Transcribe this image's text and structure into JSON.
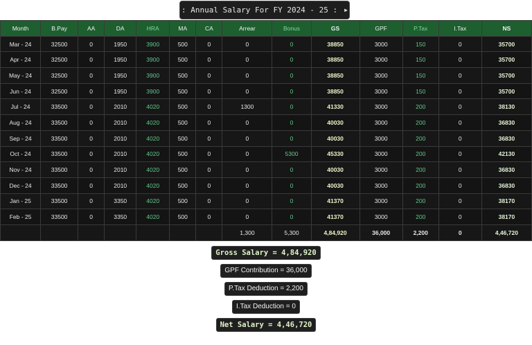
{
  "title": {
    "label": ": Annual Salary For FY  2024 - 25 :",
    "next_icon": "triangle-right-icon"
  },
  "table": {
    "columns": [
      "Month",
      "B.Pay",
      "AA",
      "DA",
      "HRA",
      "MA",
      "CA",
      "Arrear",
      "Bonus",
      "GS",
      "GPF",
      "P.Tax",
      "I.Tax",
      "NS"
    ],
    "rows": [
      [
        "Mar - 24",
        "32500",
        "0",
        "1950",
        "3900",
        "500",
        "0",
        "0",
        "0",
        "38850",
        "3000",
        "150",
        "0",
        "35700"
      ],
      [
        "Apr - 24",
        "32500",
        "0",
        "1950",
        "3900",
        "500",
        "0",
        "0",
        "0",
        "38850",
        "3000",
        "150",
        "0",
        "35700"
      ],
      [
        "May - 24",
        "32500",
        "0",
        "1950",
        "3900",
        "500",
        "0",
        "0",
        "0",
        "38850",
        "3000",
        "150",
        "0",
        "35700"
      ],
      [
        "Jun - 24",
        "32500",
        "0",
        "1950",
        "3900",
        "500",
        "0",
        "0",
        "0",
        "38850",
        "3000",
        "150",
        "0",
        "35700"
      ],
      [
        "Jul - 24",
        "33500",
        "0",
        "2010",
        "4020",
        "500",
        "0",
        "1300",
        "0",
        "41330",
        "3000",
        "200",
        "0",
        "38130"
      ],
      [
        "Aug - 24",
        "33500",
        "0",
        "2010",
        "4020",
        "500",
        "0",
        "0",
        "0",
        "40030",
        "3000",
        "200",
        "0",
        "36830"
      ],
      [
        "Sep - 24",
        "33500",
        "0",
        "2010",
        "4020",
        "500",
        "0",
        "0",
        "0",
        "40030",
        "3000",
        "200",
        "0",
        "36830"
      ],
      [
        "Oct - 24",
        "33500",
        "0",
        "2010",
        "4020",
        "500",
        "0",
        "0",
        "5300",
        "45330",
        "3000",
        "200",
        "0",
        "42130"
      ],
      [
        "Nov - 24",
        "33500",
        "0",
        "2010",
        "4020",
        "500",
        "0",
        "0",
        "0",
        "40030",
        "3000",
        "200",
        "0",
        "36830"
      ],
      [
        "Dec - 24",
        "33500",
        "0",
        "2010",
        "4020",
        "500",
        "0",
        "0",
        "0",
        "40030",
        "3000",
        "200",
        "0",
        "36830"
      ],
      [
        "Jan - 25",
        "33500",
        "0",
        "3350",
        "4020",
        "500",
        "0",
        "0",
        "0",
        "41370",
        "3000",
        "200",
        "0",
        "38170"
      ],
      [
        "Feb - 25",
        "33500",
        "0",
        "3350",
        "4020",
        "500",
        "0",
        "0",
        "0",
        "41370",
        "3000",
        "200",
        "0",
        "38170"
      ]
    ],
    "totals": [
      "",
      "",
      "",
      "",
      "",
      "",
      "",
      "1,300",
      "5,300",
      "4,84,920",
      "36,000",
      "2,200",
      "0",
      "4,46,720"
    ]
  },
  "summary": {
    "gross": "Gross Salary = 4,84,920",
    "gpf": "GPF Contribution = 36,000",
    "ptax": "P.Tax Deduction = 2,200",
    "itax": "I.Tax Deduction = 0",
    "net": "Net Salary = 4,46,720"
  },
  "colors": {
    "header_bg": "#1d5f2f",
    "table_bg": "#161616",
    "accent": "#63c98a"
  }
}
